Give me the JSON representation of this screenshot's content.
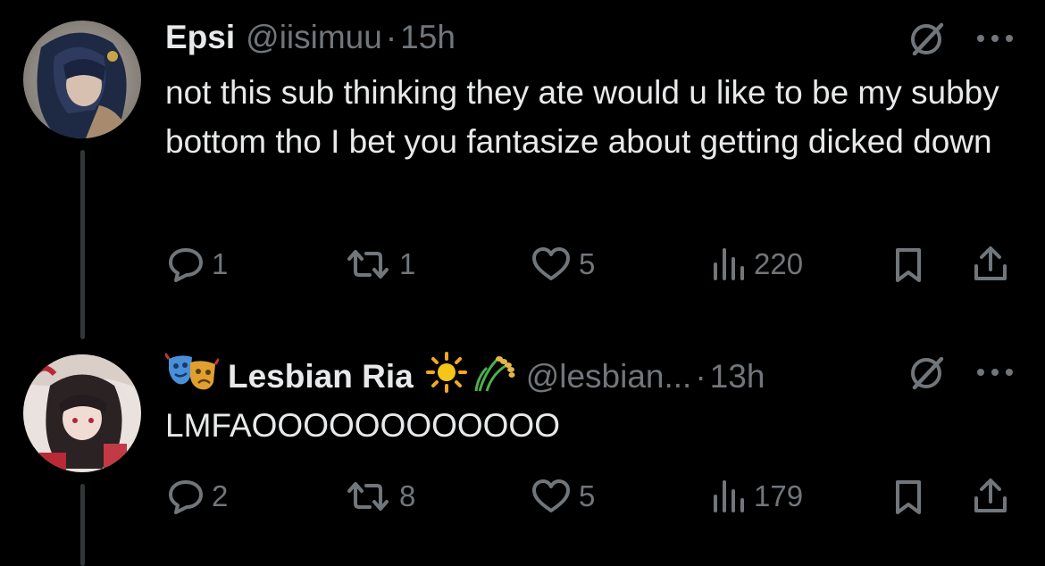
{
  "tweets": [
    {
      "display_name": "Epsi",
      "handle": "@iisimuu",
      "separator": "·",
      "time": "15h",
      "text": "not this sub thinking they ate would u like to be my subby bottom tho I bet you fantasize about getting dicked down",
      "replies": "1",
      "reposts": "1",
      "likes": "5",
      "views": "220"
    },
    {
      "display_name": "Lesbian Ria",
      "name_emojis": [
        "performing-arts-emoji",
        "sun-emoji",
        "sheaf-of-rice-emoji"
      ],
      "handle": "@lesbian...",
      "separator": "·",
      "time": "13h",
      "text": "LMFAOOOOOOOOOOOO",
      "replies": "2",
      "reposts": "8",
      "likes": "5",
      "views": "179"
    }
  ],
  "icons": [
    "grok-icon",
    "more-icon",
    "reply-icon",
    "repost-icon",
    "like-icon",
    "views-icon",
    "bookmark-icon",
    "share-icon"
  ],
  "colors": {
    "background": "#000000",
    "text": "#e7e9ea",
    "muted": "#71767b",
    "thread_line": "#333639"
  }
}
